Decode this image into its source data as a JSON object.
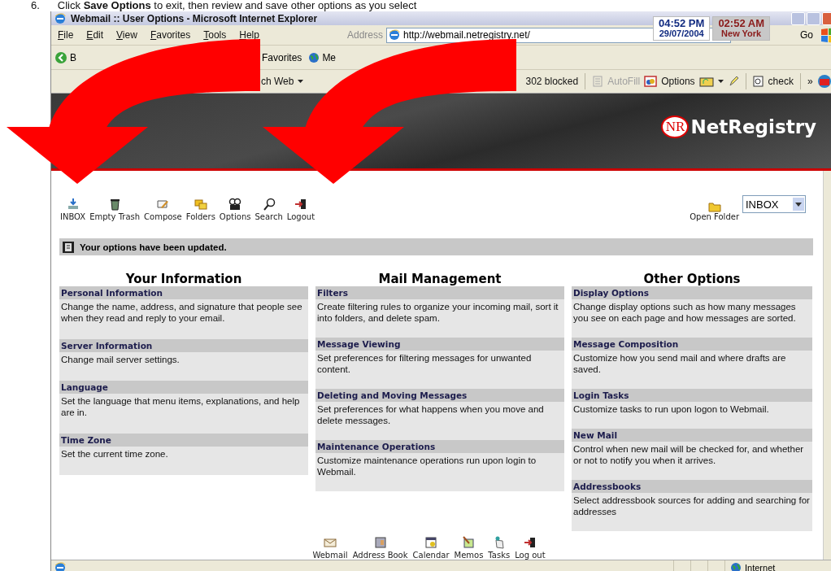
{
  "instruction": {
    "number": "6.",
    "text": "Click **Save Options** to exit, then review and save other options as you select"
  },
  "window": {
    "title": "Webmail :: User Options - Microsoft Internet Explorer"
  },
  "clocks": [
    {
      "time": "04:52 PM",
      "label": "29/07/2004",
      "kind": "local"
    },
    {
      "time": "02:52 AM",
      "label": "New York",
      "kind": "remote"
    }
  ],
  "menu": [
    "File",
    "Edit",
    "View",
    "Favorites",
    "Tools",
    "Help"
  ],
  "address": {
    "label": "Address",
    "value": "http://webmail.netregistry.net/",
    "go": "Go"
  },
  "toolbar": [
    "B",
    "Favorites",
    "Me"
  ],
  "links_toolbar": [
    {
      "label": "ch Web",
      "disabled": false
    },
    {
      "label": "302 blocked",
      "disabled": false
    },
    {
      "label": "AutoFill",
      "disabled": true
    },
    {
      "label": "Options",
      "disabled": false
    },
    {
      "label": "check",
      "disabled": false
    },
    {
      "label": "»",
      "disabled": false
    }
  ],
  "logo": {
    "mark": "NR",
    "name": "NetRegistry"
  },
  "nav": [
    "INBOX",
    "Empty Trash",
    "Compose",
    "Folders",
    "Options",
    "Search",
    "Logout"
  ],
  "open_folder": {
    "label": "Open Folder",
    "value": "INBOX"
  },
  "notice": "Your options have been updated.",
  "columns": [
    {
      "title": "Your Information",
      "sections": [
        {
          "heading": "Personal Information",
          "text": "Change the name, address, and signature that people see when they read and reply to your email."
        },
        {
          "heading": "Server Information",
          "text": "Change mail server settings."
        },
        {
          "heading": "Language",
          "text": "Set the language that menu items, explanations, and help are in."
        },
        {
          "heading": "Time Zone",
          "text": "Set the current time zone."
        }
      ]
    },
    {
      "title": "Mail Management",
      "sections": [
        {
          "heading": "Filters",
          "text": "Create filtering rules to organize your incoming mail, sort it into folders, and delete spam."
        },
        {
          "heading": "Message Viewing",
          "text": "Set preferences for filtering messages for unwanted content."
        },
        {
          "heading": "Deleting and Moving Messages",
          "text": "Set preferences for what happens when you move and delete messages."
        },
        {
          "heading": "Maintenance Operations",
          "text": "Customize maintenance operations run upon login to Webmail."
        }
      ]
    },
    {
      "title": "Other Options",
      "sections": [
        {
          "heading": "Display Options",
          "text": "Change display options such as how many messages you see on each page and how messages are sorted."
        },
        {
          "heading": "Message Composition",
          "text": "Customize how you send mail and where drafts are saved."
        },
        {
          "heading": "Login Tasks",
          "text": "Customize tasks to run upon logon to Webmail."
        },
        {
          "heading": "New Mail",
          "text": "Control when new mail will be checked for, and whether or not to notify you when it arrives."
        },
        {
          "heading": "Addressbooks",
          "text": "Select addressbook sources for adding and searching for addresses"
        }
      ]
    }
  ],
  "bottom_nav": [
    "Webmail",
    "Address Book",
    "Calendar",
    "Memos",
    "Tasks",
    "Log out"
  ],
  "status_bar": {
    "zone": "Internet"
  }
}
